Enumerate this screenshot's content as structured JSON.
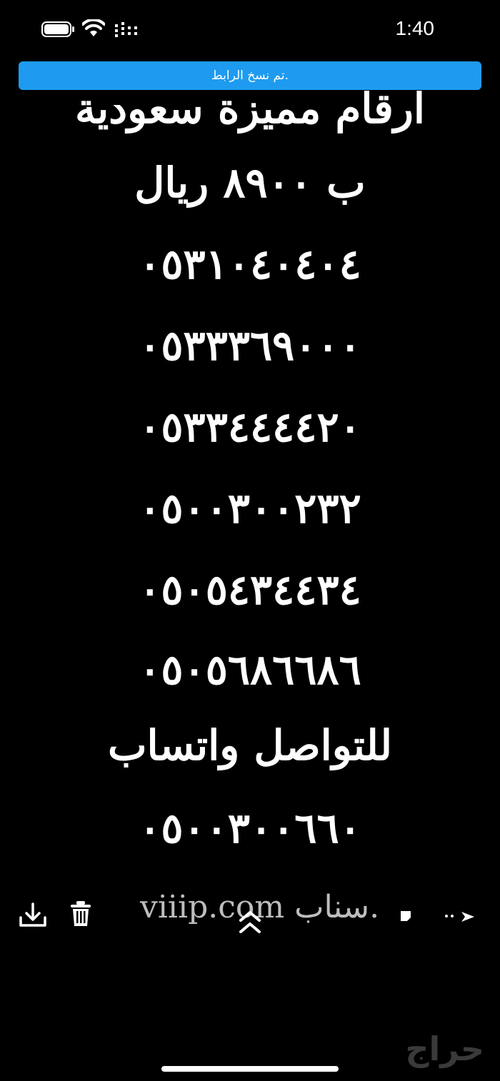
{
  "status_bar": {
    "time": "1:40"
  },
  "toast": {
    "text": "تم نسخ الرابط."
  },
  "post": {
    "lines": [
      "ارقام مميزة سعودية",
      "ب ٨٩٠٠ ريال",
      "٠٥٣١٠٤٠٤٠٤",
      "٠٥٣٣٣٦٩٠٠٠",
      "٠٥٣٣٤٤٤٤٢٠",
      "٠٥٠٠٣٠٠٢٣٢",
      "٠٥٠٥٤٣٤٤٣٤",
      "٠٥٠٥٦٨٦٦٨٦",
      "للتواصل واتساب",
      "٠٥٠٠٣٠٠٦٦٠"
    ]
  },
  "toolbar": {
    "caption": "viiip.com سناب."
  },
  "watermark": {
    "text": "حراج"
  },
  "icons": {
    "download": "download-icon",
    "trash": "trash-icon",
    "chevron": "chevron-up-icon",
    "sticker": "sticker-icon",
    "forward": "forward-icon"
  }
}
